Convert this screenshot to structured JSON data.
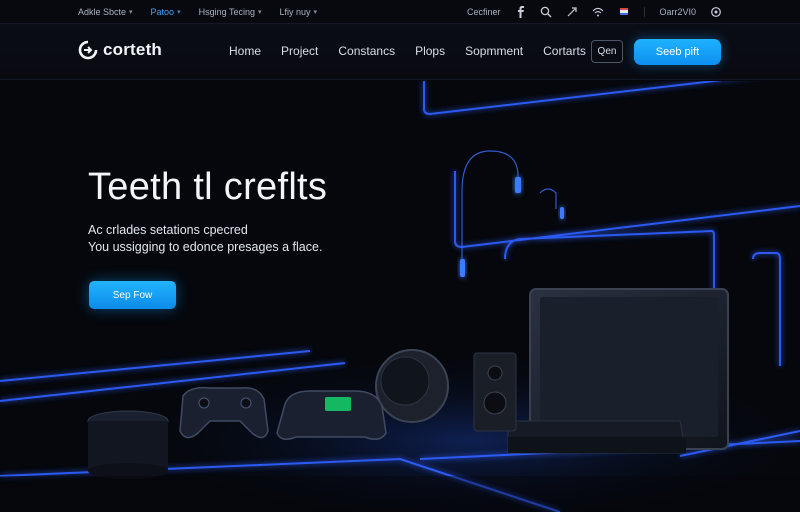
{
  "utility": {
    "links": [
      {
        "label": "Adkle Sbcte",
        "active": false
      },
      {
        "label": "Patoo",
        "active": true
      },
      {
        "label": "Hsging Tecing",
        "active": false
      },
      {
        "label": "Lfiy nuy",
        "active": false
      }
    ],
    "contact_label": "Cecfiner",
    "phone_label": "Oarr2VI0"
  },
  "nav": {
    "logo_text": "corteth",
    "links": [
      "Home",
      "Project",
      "Constancs",
      "Plops",
      "Sopmment",
      "Cortarts"
    ],
    "outline_button": "Qen",
    "cta_label": "Seeb pift"
  },
  "hero": {
    "title": "Teeth  tl creflts",
    "subtitle_line1": "Ac crlades setations cpecred",
    "subtitle_line2": "You ussigging to edonce presages a flace.",
    "cta_label": "Sep Fow"
  },
  "colors": {
    "accent": "#1aa7ff",
    "neon": "#2f62ff",
    "background": "#05070c"
  },
  "icons": [
    "facebook-icon",
    "search-icon",
    "share-icon",
    "wifi-icon",
    "flag-icon",
    "settings-icon"
  ]
}
